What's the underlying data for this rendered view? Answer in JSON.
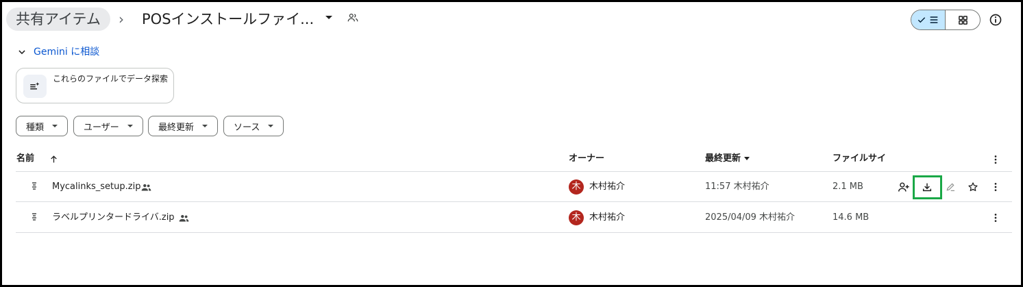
{
  "header": {
    "root_crumb": "共有アイテム",
    "separator": "›",
    "current_folder": "POSインストールファイ..."
  },
  "gemini": {
    "toggle_label": "Gemini に相談",
    "suggestion": "これらのファイルでデータ探索"
  },
  "filters": [
    {
      "label": "種類"
    },
    {
      "label": "ユーザー"
    },
    {
      "label": "最終更新"
    },
    {
      "label": "ソース"
    }
  ],
  "table": {
    "columns": {
      "name": "名前",
      "owner": "オーナー",
      "modified": "最終更新",
      "size": "ファイルサイ"
    },
    "rows": [
      {
        "name": "Mycalinks_setup.zip",
        "owner_initial": "木",
        "owner": "木村祐介",
        "modified": "11:57 木村祐介",
        "size": "2.1 MB"
      },
      {
        "name": "ラベルプリンタードライバ.zip",
        "owner_initial": "木",
        "owner": "木村祐介",
        "modified": "2025/04/09 木村祐介",
        "size": "14.6 MB"
      }
    ]
  },
  "colors": {
    "accent_blue": "#0b57d0",
    "selected_toggle": "#c2e7ff",
    "avatar": "#b3261e",
    "highlight": "#1aa847"
  },
  "icons": [
    "chevron-right-icon",
    "caret-down-icon",
    "shared-people-icon",
    "check-icon",
    "list-view-icon",
    "grid-view-icon",
    "info-icon",
    "chevron-down-icon",
    "data-insight-icon",
    "sort-arrow-up-icon",
    "zip-file-icon",
    "add-person-icon",
    "download-icon",
    "rename-icon",
    "star-icon",
    "more-vert-icon"
  ]
}
